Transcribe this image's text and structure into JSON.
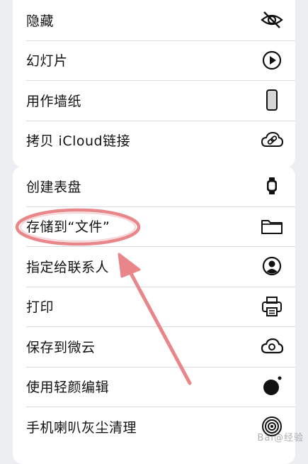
{
  "menu": {
    "group1": [
      {
        "label": "隐藏",
        "icon": "eye-slash-icon"
      },
      {
        "label": "幻灯片",
        "icon": "play-circle-icon"
      },
      {
        "label": "用作墙纸",
        "icon": "phone-icon"
      },
      {
        "label": "拷贝 iCloud链接",
        "icon": "cloud-link-icon"
      }
    ],
    "group2": [
      {
        "label": "创建表盘",
        "icon": "watch-icon"
      },
      {
        "label": "存储到“文件”",
        "icon": "folder-icon"
      },
      {
        "label": "指定给联系人",
        "icon": "person-circle-icon"
      },
      {
        "label": "打印",
        "icon": "printer-icon"
      },
      {
        "label": "保存到微云",
        "icon": "weiyun-cloud-icon"
      },
      {
        "label": "使用轻颜编辑",
        "icon": "black-dot-icon"
      },
      {
        "label": "手机喇叭灰尘清理",
        "icon": "speaker-clean-icon"
      }
    ]
  },
  "annotation": {
    "highlight_color": "#e8868a"
  },
  "watermark": {
    "text": "Bai@经验"
  }
}
